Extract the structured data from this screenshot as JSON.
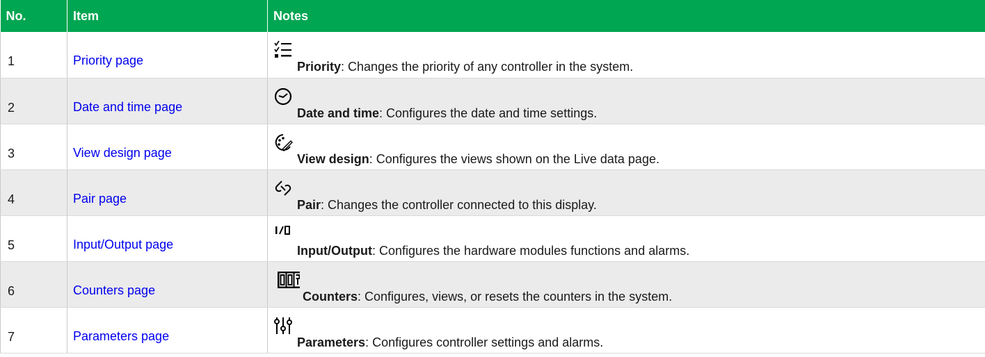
{
  "table": {
    "headers": {
      "no": "No.",
      "item": "Item",
      "notes": "Notes"
    },
    "rows": [
      {
        "no": "1",
        "item": "Priority page",
        "icon": "priority-list-icon",
        "note_title": "Priority",
        "note_body": ": Changes the priority of any controller in the system."
      },
      {
        "no": "2",
        "item": "Date and time page",
        "icon": "clock-icon",
        "note_title": "Date and time",
        "note_body": ": Configures the date and time settings."
      },
      {
        "no": "3",
        "item": "View design page",
        "icon": "view-design-icon",
        "note_title": "View design",
        "note_body": ": Configures the views shown on the Live data page."
      },
      {
        "no": "4",
        "item": "Pair page",
        "icon": "pair-link-icon",
        "note_title": "Pair",
        "note_body": ": Changes the controller connected to this display."
      },
      {
        "no": "5",
        "item": "Input/Output page",
        "icon": "input-output-icon",
        "note_title": "Input/Output",
        "note_body": ": Configures the hardware modules functions and alarms."
      },
      {
        "no": "6",
        "item": "Counters page",
        "icon": "counter-icon",
        "note_title": "Counters",
        "note_body": ": Configures, views, or resets the counters in the system."
      },
      {
        "no": "7",
        "item": "Parameters page",
        "icon": "sliders-icon",
        "note_title": "Parameters",
        "note_body": ": Configures controller settings and alarms."
      }
    ]
  },
  "colors": {
    "header_bg": "#00a651",
    "link": "#0000ee",
    "stripe": "#ebebeb"
  }
}
